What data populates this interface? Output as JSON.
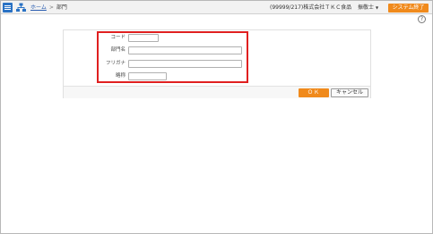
{
  "header": {
    "menu_icon": "hamburger-icon",
    "org_icon": "org-chart-icon",
    "breadcrumb": {
      "home": "ホーム",
      "separator": ">",
      "current": "部門"
    },
    "company": "(99999/217)株式会社ＴＫＣ食品",
    "user": "振敬士",
    "exit_label": "システム終了",
    "help_icon": "question-circle-icon",
    "help_glyph": "?"
  },
  "form": {
    "fields": [
      {
        "label": "コード",
        "value": "",
        "placeholder": ""
      },
      {
        "label": "部門名",
        "value": "",
        "placeholder": ""
      },
      {
        "label": "フリガナ",
        "value": "",
        "placeholder": ""
      },
      {
        "label": "略称",
        "value": "",
        "placeholder": ""
      }
    ],
    "ok_label": "ＯＫ",
    "cancel_label": "キャンセル"
  },
  "colors": {
    "accent": "#f08a1c",
    "menu": "#2a72c4",
    "highlight": "#e02020"
  }
}
